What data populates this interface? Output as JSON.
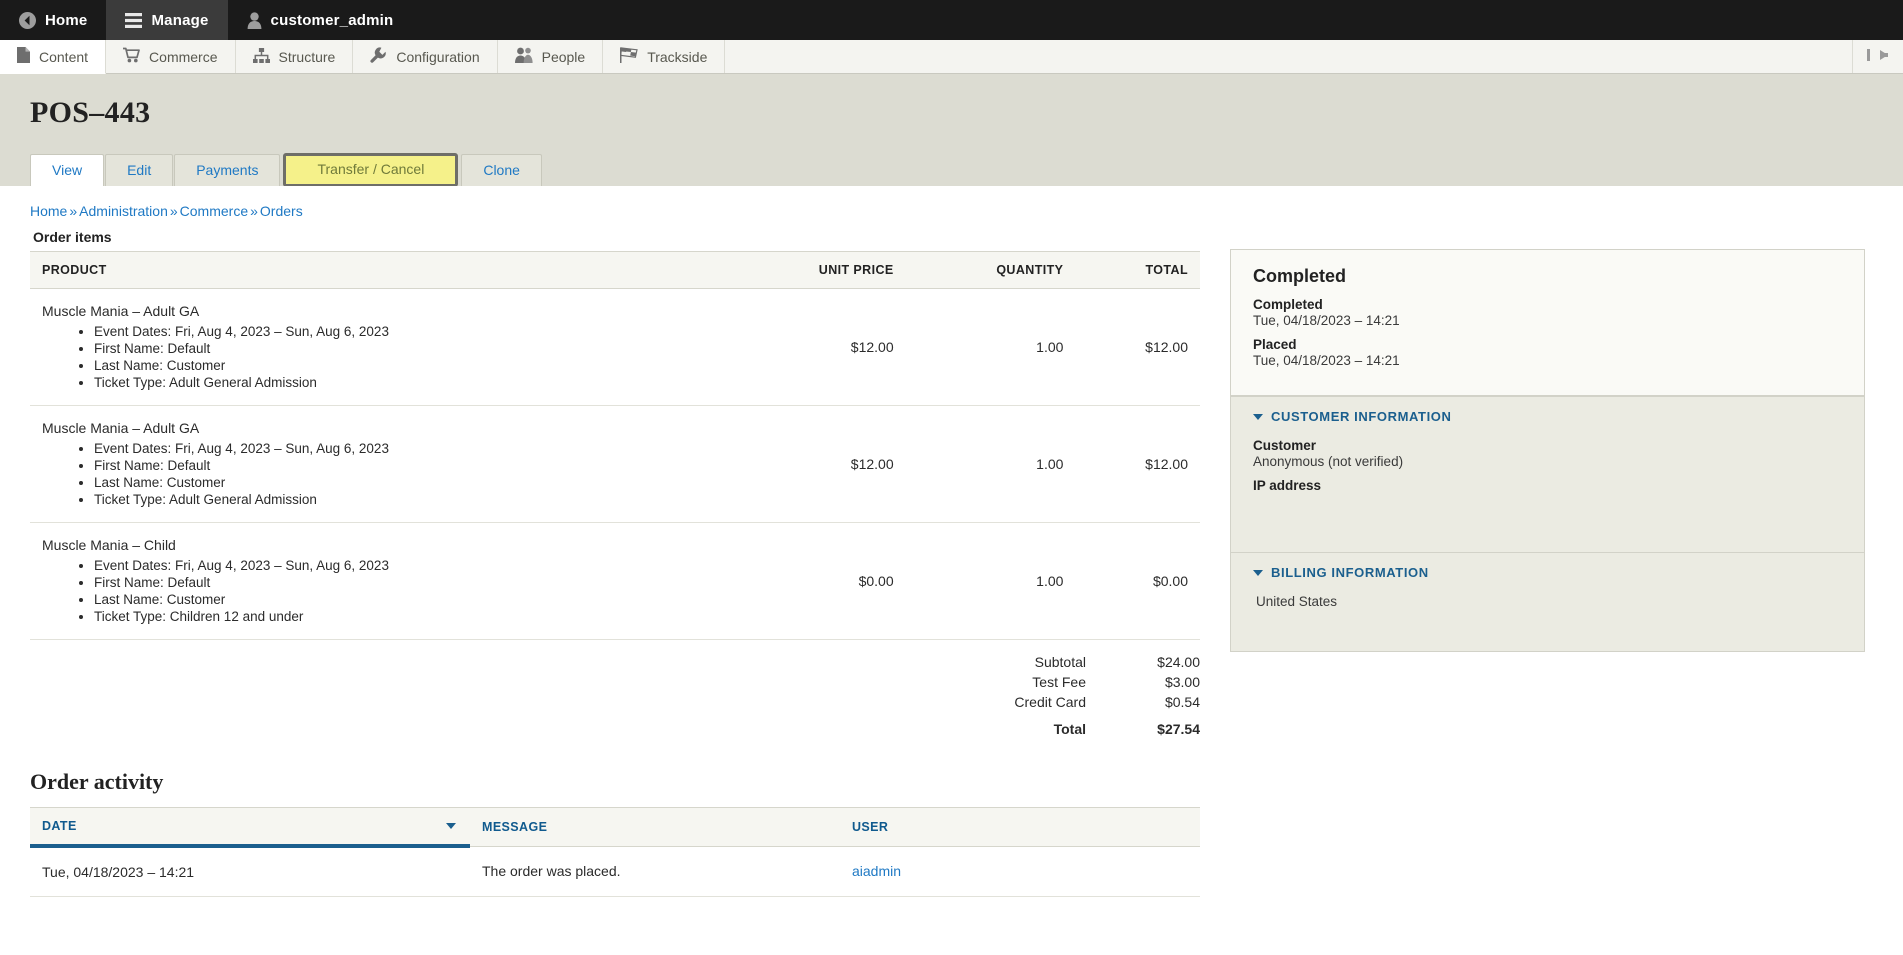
{
  "toolbar": {
    "items": [
      {
        "label": "Home",
        "icon": "back-circle-icon",
        "active": false
      },
      {
        "label": "Manage",
        "icon": "hamburger-icon",
        "active": true
      },
      {
        "label": "customer_admin",
        "icon": "user-icon",
        "active": false
      }
    ]
  },
  "menu": {
    "items": [
      {
        "label": "Content",
        "icon": "page-icon"
      },
      {
        "label": "Commerce",
        "icon": "cart-icon"
      },
      {
        "label": "Structure",
        "icon": "sitemap-icon"
      },
      {
        "label": "Configuration",
        "icon": "wrench-icon"
      },
      {
        "label": "People",
        "icon": "people-icon"
      },
      {
        "label": "Trackside",
        "icon": "checkered-flag-icon"
      }
    ],
    "collapse_icon": "collapse-left-icon"
  },
  "page": {
    "title": "POS–443",
    "tabs": [
      {
        "label": "View",
        "state": "active"
      },
      {
        "label": "Edit",
        "state": "normal"
      },
      {
        "label": "Payments",
        "state": "normal"
      },
      {
        "label": "Transfer / Cancel",
        "state": "hovered"
      },
      {
        "label": "Clone",
        "state": "normal"
      }
    ]
  },
  "breadcrumb": {
    "items": [
      "Home",
      "Administration",
      "Commerce",
      "Orders"
    ],
    "separator": "»"
  },
  "order_items": {
    "section_label": "Order items",
    "columns": [
      "PRODUCT",
      "UNIT PRICE",
      "QUANTITY",
      "TOTAL"
    ],
    "rows": [
      {
        "product": "Muscle Mania – Adult GA",
        "attributes": [
          "Event Dates: Fri, Aug 4, 2023 – Sun, Aug 6, 2023",
          "First Name: Default",
          "Last Name: Customer",
          "Ticket Type: Adult General Admission"
        ],
        "unit_price": "$12.00",
        "quantity": "1.00",
        "total": "$12.00"
      },
      {
        "product": "Muscle Mania – Adult GA",
        "attributes": [
          "Event Dates: Fri, Aug 4, 2023 – Sun, Aug 6, 2023",
          "First Name: Default",
          "Last Name: Customer",
          "Ticket Type: Adult General Admission"
        ],
        "unit_price": "$12.00",
        "quantity": "1.00",
        "total": "$12.00"
      },
      {
        "product": "Muscle Mania – Child",
        "attributes": [
          "Event Dates: Fri, Aug 4, 2023 – Sun, Aug 6, 2023",
          "First Name: Default",
          "Last Name: Customer",
          "Ticket Type: Children 12 and under"
        ],
        "unit_price": "$0.00",
        "quantity": "1.00",
        "total": "$0.00"
      }
    ],
    "totals": [
      {
        "label": "Subtotal",
        "value": "$24.00",
        "grand": false
      },
      {
        "label": "Test Fee",
        "value": "$3.00",
        "grand": false
      },
      {
        "label": "Credit Card",
        "value": "$0.54",
        "grand": false
      },
      {
        "label": "Total",
        "value": "$27.54",
        "grand": true
      }
    ]
  },
  "activity": {
    "title": "Order activity",
    "columns": [
      {
        "label": "DATE",
        "sorted": true,
        "sort_dir": "desc"
      },
      {
        "label": "MESSAGE",
        "sorted": false
      },
      {
        "label": "USER",
        "sorted": false
      }
    ],
    "rows": [
      {
        "date": "Tue, 04/18/2023 – 14:21",
        "message": "The order was placed.",
        "user": "aiadmin"
      }
    ]
  },
  "sidebar": {
    "status_panel": {
      "heading": "Completed",
      "fields": [
        {
          "label": "Completed",
          "value": "Tue, 04/18/2023 – 14:21"
        },
        {
          "label": "Placed",
          "value": "Tue, 04/18/2023 – 14:21"
        }
      ]
    },
    "customer_panel": {
      "title": "CUSTOMER INFORMATION",
      "fields": [
        {
          "label": "Customer",
          "value": "Anonymous (not verified)"
        },
        {
          "label": "IP address",
          "value": ""
        }
      ]
    },
    "billing_panel": {
      "title": "BILLING INFORMATION",
      "lines": [
        "United States"
      ]
    }
  },
  "colors": {
    "link": "#1f79c4",
    "heading_link": "#1b5f8e",
    "toolbar_bg": "#1a1a1a",
    "page_head_bg": "#dcdcd2",
    "hover_tab_bg": "#f5f18a",
    "panel_bg": "#ebebe2"
  }
}
